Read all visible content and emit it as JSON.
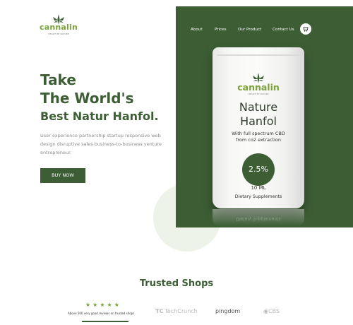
{
  "brand": {
    "name": "cannalin",
    "tagline": "HEALTH BY NATURE"
  },
  "nav": {
    "items": [
      "About",
      "Prices",
      "Our Product",
      "Contact Us"
    ]
  },
  "hero": {
    "line1": "Take",
    "line2": "The World's",
    "line3": "Best Natur Hanfol.",
    "lead": "User experience partnership startup responsive web design disruptive sales business-to-business venture entrepreneur.",
    "cta": "BUY NOW"
  },
  "product": {
    "brand": "cannalin",
    "tagline": "HEALTH BY NATURE",
    "name_line1": "Nature",
    "name_line2": "Hanfol",
    "desc": "With full spectrum CBD from co2 extraction",
    "badge": "2.5%",
    "volume": "10 ML",
    "type": "Dietary Supplements"
  },
  "trusted": {
    "title": "Trusted Shops",
    "stars": "★★★★★",
    "reviews": "Above 500 very good reviews on trusted shops",
    "logos": [
      "TechCrunch",
      "pingdom",
      "CBS"
    ]
  },
  "colors": {
    "primary": "#3d5e35",
    "accent": "#7aa23a"
  },
  "icons": {
    "cart": "cart-icon",
    "leaf": "cannabis-leaf-icon"
  }
}
